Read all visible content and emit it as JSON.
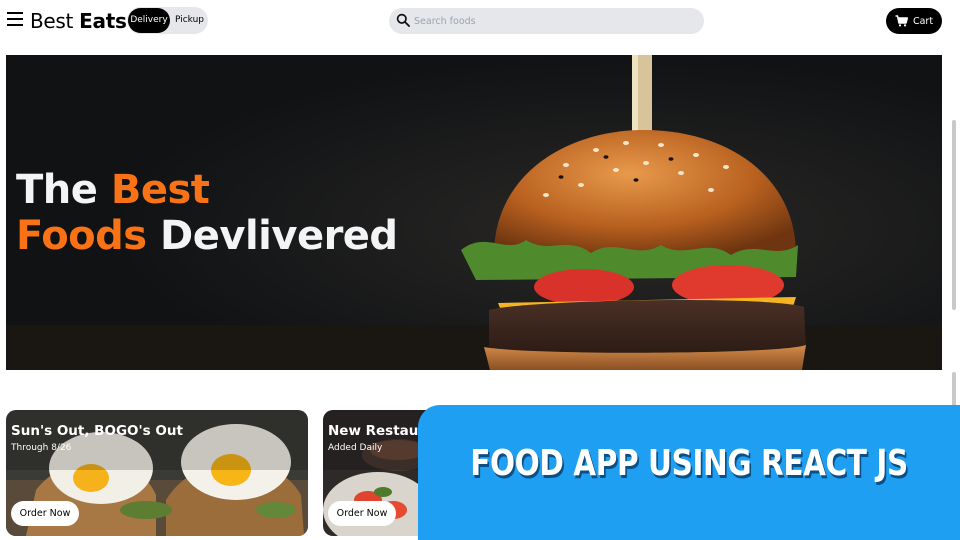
{
  "navbar": {
    "brand_light": "Best",
    "brand_bold": "Eats",
    "delivery_label": "Delivery",
    "pickup_label": "Pickup",
    "search_placeholder": "Search foods",
    "cart_label": "Cart"
  },
  "hero": {
    "line1_normal": "The",
    "line1_accent": "Best",
    "line2_accent": "Foods",
    "line2_normal": "Devlivered"
  },
  "cards": [
    {
      "title": "Sun's Out, BOGO's Out",
      "subtitle": "Through 8/26",
      "button": "Order Now"
    },
    {
      "title": "New Restaurants",
      "subtitle": "Added Daily",
      "button": "Order Now"
    }
  ],
  "banner": {
    "text": "FOOD APP USING REACT JS"
  },
  "colors": {
    "accent": "#f97316",
    "banner": "#1e9ff2",
    "dark": "#000000",
    "pill": "#e5e7eb"
  },
  "icons": [
    "menu-icon",
    "search-icon",
    "cart-icon"
  ]
}
